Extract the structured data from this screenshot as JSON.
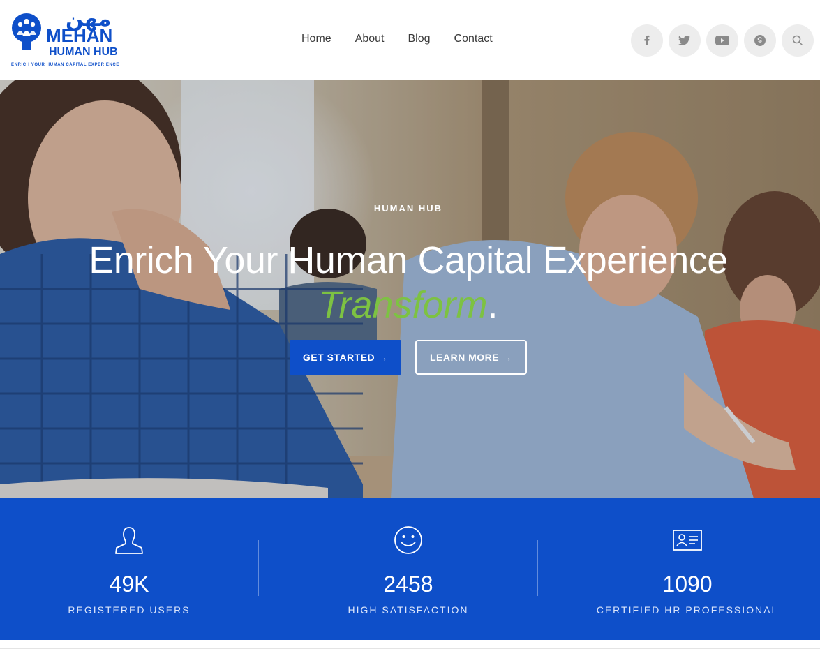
{
  "brand": {
    "arabic": "مهن",
    "name": "MEHAN",
    "sub": "HUMAN HUB",
    "tagline": "ENRICH YOUR HUMAN CAPITAL EXPERIENCE",
    "color": "#0e4fc9"
  },
  "nav": {
    "items": [
      {
        "label": "Home"
      },
      {
        "label": "About"
      },
      {
        "label": "Blog"
      },
      {
        "label": "Contact"
      }
    ]
  },
  "socials": [
    {
      "icon": "facebook-icon"
    },
    {
      "icon": "twitter-icon"
    },
    {
      "icon": "youtube-icon"
    },
    {
      "icon": "skype-icon"
    },
    {
      "icon": "search-icon"
    }
  ],
  "hero": {
    "eyebrow": "HUMAN HUB",
    "headline": "Enrich Your Human Capital Experience",
    "accent_word": "Transform",
    "accent_suffix": ".",
    "accent_color": "#7dc242",
    "primary_button": "GET STARTED →",
    "secondary_button": "LEARN MORE →"
  },
  "stats": [
    {
      "icon": "user-icon",
      "value": "49K",
      "label": "REGISTERED USERS"
    },
    {
      "icon": "smiley-icon",
      "value": "2458",
      "label": "HIGH SATISFACTION"
    },
    {
      "icon": "id-card-icon",
      "value": "1090",
      "label": "CERTIFIED HR PROFESSIONAL"
    }
  ],
  "colors": {
    "primary": "#0e4fc9",
    "accent": "#7dc242",
    "nav_text": "#3a3a3a"
  }
}
